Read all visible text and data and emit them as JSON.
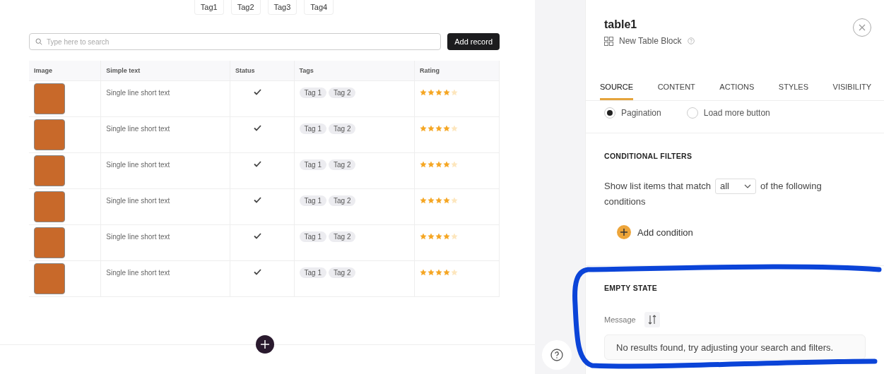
{
  "filter_tags": [
    "Tag1",
    "Tag2",
    "Tag3",
    "Tag4"
  ],
  "search": {
    "placeholder": "Type here to search"
  },
  "add_button": "Add record",
  "table": {
    "columns": [
      "Image",
      "Simple text",
      "Status",
      "Tags",
      "Rating"
    ],
    "rows": [
      {
        "text": "Single line short text",
        "checked": true,
        "tags": [
          "Tag 1",
          "Tag 2"
        ],
        "stars": 4
      },
      {
        "text": "Single line short text",
        "checked": true,
        "tags": [
          "Tag 1",
          "Tag 2"
        ],
        "stars": 4
      },
      {
        "text": "Single line short text",
        "checked": true,
        "tags": [
          "Tag 1",
          "Tag 2"
        ],
        "stars": 4
      },
      {
        "text": "Single line short text",
        "checked": true,
        "tags": [
          "Tag 1",
          "Tag 2"
        ],
        "stars": 4
      },
      {
        "text": "Single line short text",
        "checked": true,
        "tags": [
          "Tag 1",
          "Tag 2"
        ],
        "stars": 4
      },
      {
        "text": "Single line short text",
        "checked": true,
        "tags": [
          "Tag 1",
          "Tag 2"
        ],
        "stars": 4
      }
    ]
  },
  "panel": {
    "title": "table1",
    "subtitle": "New Table Block",
    "tabs": [
      {
        "label": "SOURCE",
        "selected": true
      },
      {
        "label": "CONTENT",
        "selected": false
      },
      {
        "label": "ACTIONS",
        "selected": false
      },
      {
        "label": "STYLES",
        "selected": false
      },
      {
        "label": "VISIBILITY",
        "selected": false
      }
    ],
    "pagination_options": [
      {
        "label": "Pagination",
        "selected": true
      },
      {
        "label": "Load more button",
        "selected": false
      }
    ],
    "conditional_filters": {
      "heading": "CONDITIONAL FILTERS",
      "text_before": "Show list items that match",
      "match": "all",
      "text_after": [
        "of the following",
        "conditions"
      ],
      "add_condition": "Add condition"
    },
    "empty_state": {
      "heading": "EMPTY STATE",
      "label": "Message",
      "value": "No results found, try adjusting your search and filters."
    }
  }
}
